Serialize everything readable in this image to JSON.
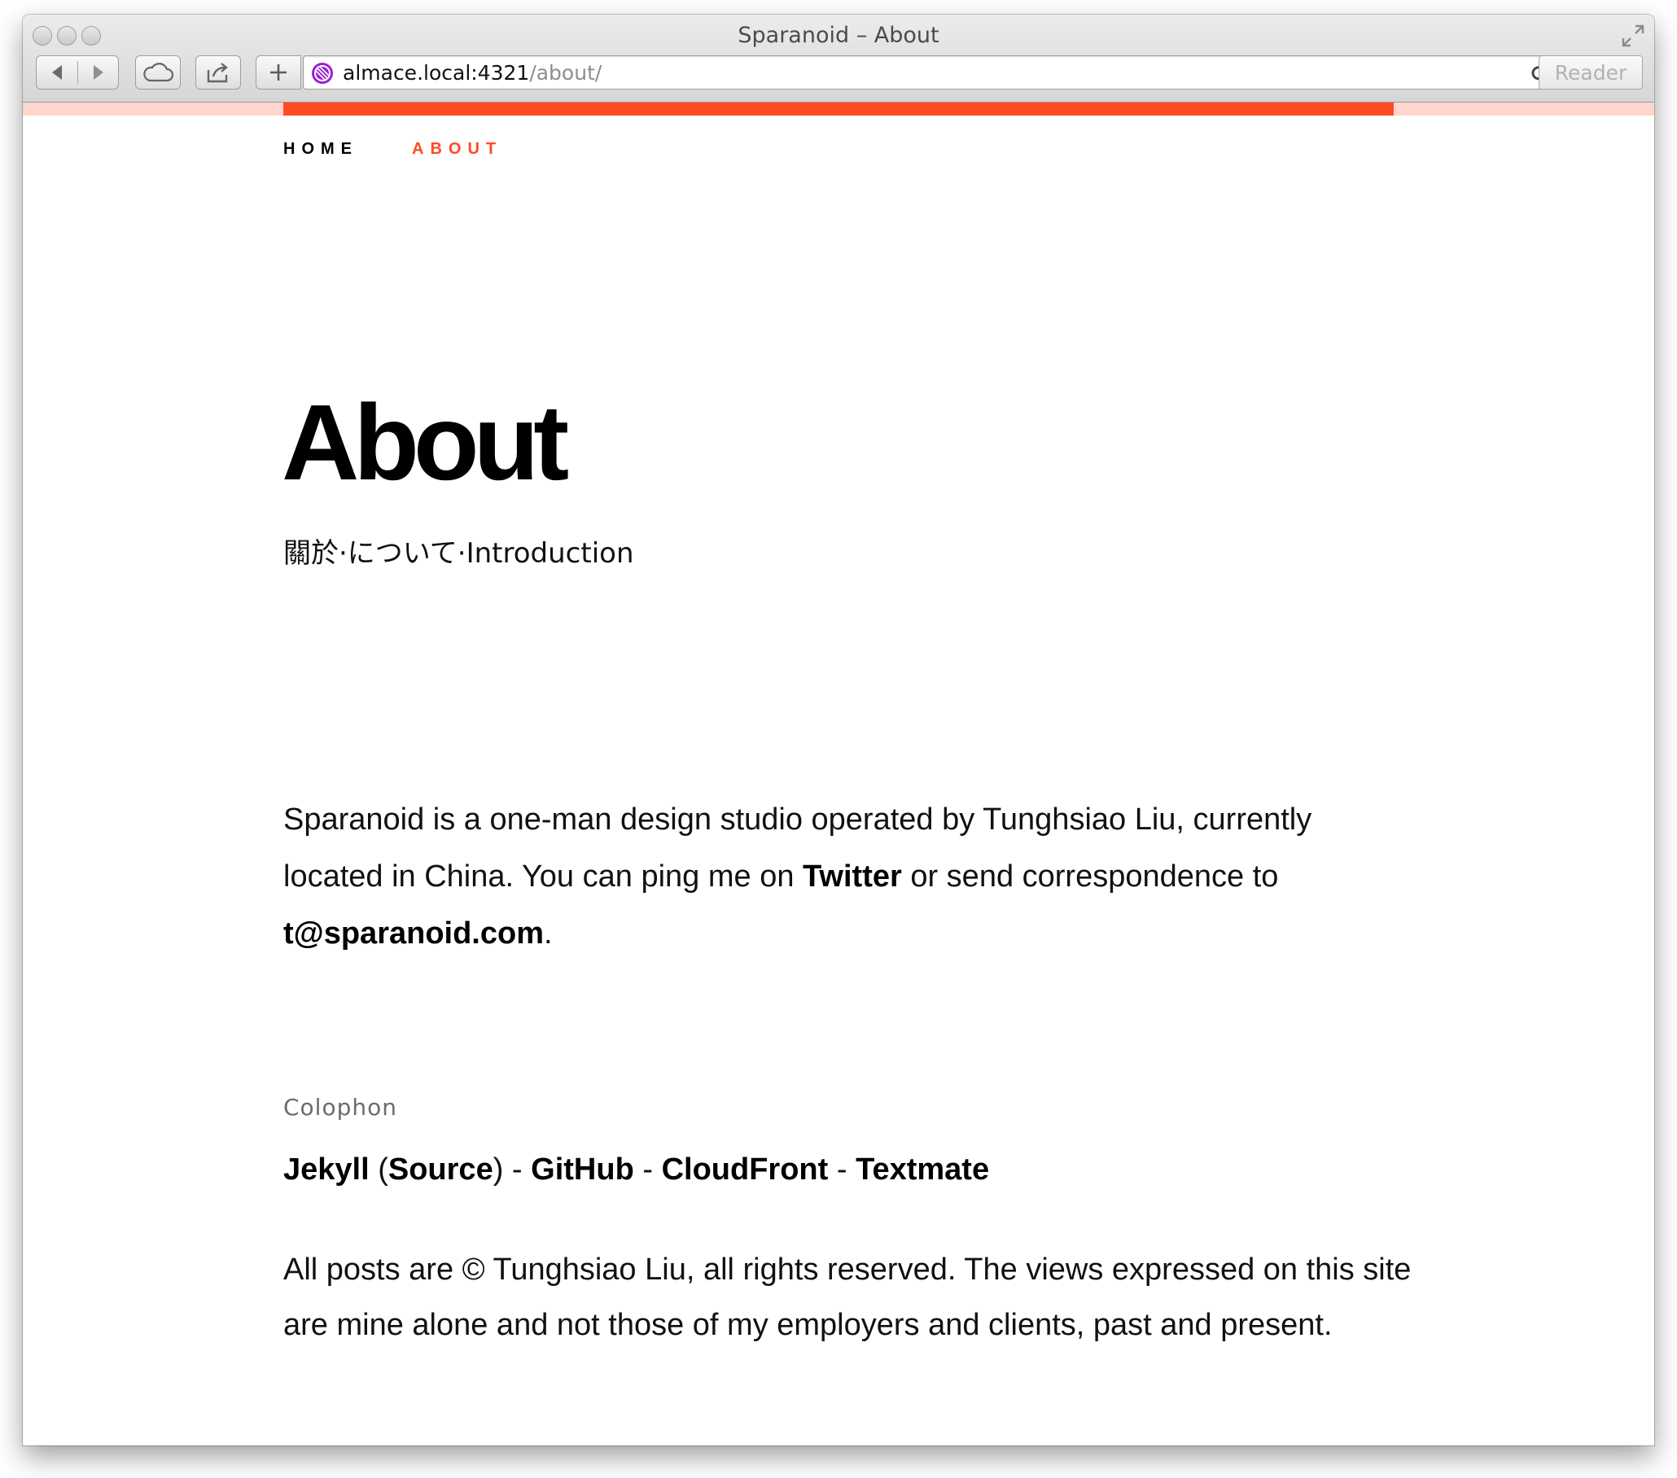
{
  "browser": {
    "window_title": "Sparanoid – About",
    "url_host": "almace.local:4321",
    "url_path": "/about/",
    "reader_label": "Reader",
    "icons": {
      "back": "back-arrow-icon",
      "forward": "forward-arrow-icon",
      "icloud": "cloud-icon",
      "share": "share-icon",
      "new_tab": "plus-icon",
      "favicon": "site-favicon-icon",
      "reload": "reload-icon",
      "fullscreen": "fullscreen-icon"
    }
  },
  "theme": {
    "accent": "#ff4a24",
    "accent_light": "#ffd6cc",
    "text": "#000000",
    "muted": "#6c6c6c"
  },
  "progress": {
    "value": 0.68
  },
  "nav": {
    "items": [
      {
        "label": "HOME",
        "active": false
      },
      {
        "label": "ABOUT",
        "active": true
      }
    ]
  },
  "header": {
    "title": "About",
    "subtitle": "關於·について·Introduction"
  },
  "intro": {
    "part1": "Sparanoid is a one-man design studio operated by Tunghsiao Liu, currently located in China. You can ping me on ",
    "twitter_link": "Twitter",
    "part2": " or send correspondence to ",
    "email_link": "t@sparanoid.com",
    "part3": "."
  },
  "colophon": {
    "label": "Colophon",
    "jekyll": "Jekyll",
    "open_paren": " (",
    "source": "Source",
    "close_paren": ")",
    "sep": " - ",
    "github": "GitHub",
    "cloudfront": "CloudFront",
    "textmate": "Textmate"
  },
  "footer": {
    "copyright": "All posts are © Tunghsiao Liu, all rights reserved. The views expressed on this site are mine alone and not those of my employers and clients, past and present."
  }
}
